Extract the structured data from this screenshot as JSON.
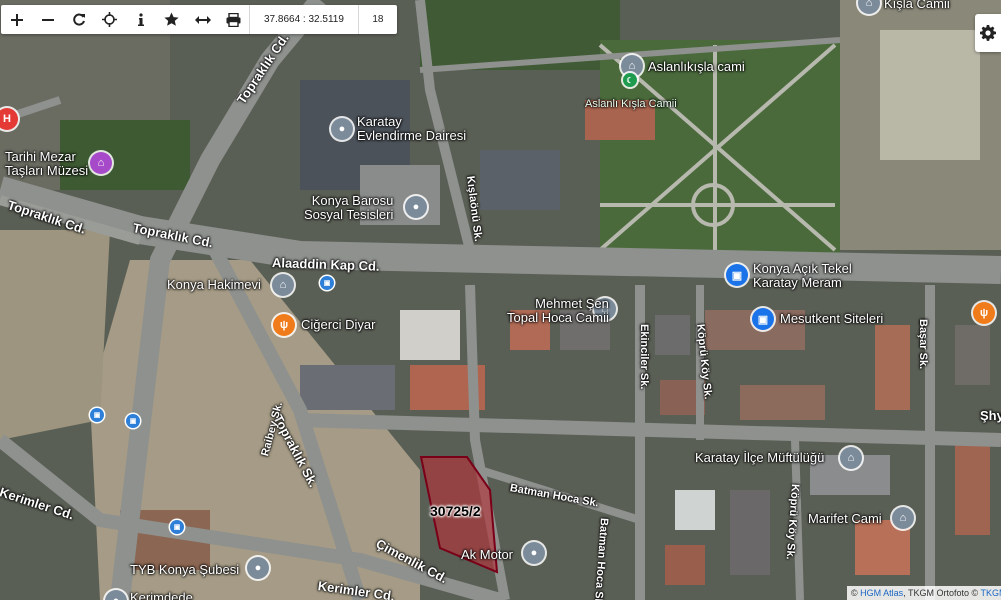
{
  "toolbar": {
    "buttons": [
      {
        "name": "zoom-in",
        "icon": "plus-icon"
      },
      {
        "name": "zoom-out",
        "icon": "minus-icon"
      },
      {
        "name": "refresh",
        "icon": "refresh-icon"
      },
      {
        "name": "locate",
        "icon": "crosshair-icon"
      },
      {
        "name": "info",
        "icon": "info-icon"
      },
      {
        "name": "favorite",
        "icon": "star-icon"
      },
      {
        "name": "measure",
        "icon": "measure-icon"
      },
      {
        "name": "print",
        "icon": "print-icon"
      }
    ],
    "coordinates": "37.8664 : 32.5119",
    "zoom": "18"
  },
  "settings_icon": "gear-icon",
  "parcel": {
    "label": "30725/2",
    "color": "#7a0019"
  },
  "places": {
    "kisla_camii": "Kışla Camii",
    "aslanlikisla_cami": "Aslanlıkışla cami",
    "aslanli_kisla_camii": "Aslanlı Kışla Camii",
    "karatay_evlendirme": "Karatay\nEvlendirme Dairesi",
    "konya_barosu": "Konya Barosu\nSosyal Tesisleri",
    "tarihi_mezar": "Tarihi Mezar\nTaşları Müzesi",
    "konya_hakimevi": "Konya Hakimevi",
    "cigerci_diyar": "Ciğerci Diyar",
    "mehmet_sen": "Mehmet Şen\nTopal Hoca Camii",
    "konya_acik_tekel": "Konya Açık Tekel\nKaratay Meram",
    "mesutkent": "Mesutkent Siteleri",
    "karatay_muftulugu": "Karatay İlçe Müftülüğü",
    "marifet_cami": "Marifet Cami",
    "ak_motor": "Ak Motor",
    "tyb_konya": "TYB Konya Şubesi",
    "kerimdede": "Kerimdede",
    "shy": "Şhy"
  },
  "streets": {
    "topraklik1": "Topraklık Cd.",
    "topraklik2": "Topraklık Cd.",
    "topraklik3": "Topraklık Cd.",
    "topraklik_sk": "Topraklık Sk.",
    "alaaddin": "Alaaddin Kap Cd.",
    "kislaonu": "Kışlaönü Sk.",
    "ekinciler": "Ekinciler Sk.",
    "koprukoy1": "Köprü Köy Sk.",
    "koprukoy2": "Köprü Köy Sk.",
    "basar": "Başar Sk.",
    "batman": "Batman Hoca Sk.",
    "batman2": "Batman Hoca Sk.",
    "raibey": "Raibey Sk.",
    "cimenlik": "Çimenlik Cd.",
    "kerimler": "Kerimler Cd.",
    "kerimler2": "Kerimler Cd."
  },
  "attribution": {
    "copy1": "© ",
    "link1": "HGM Atlas",
    "mid": ", TKGM Ortofoto © ",
    "link2": "TKGM"
  }
}
